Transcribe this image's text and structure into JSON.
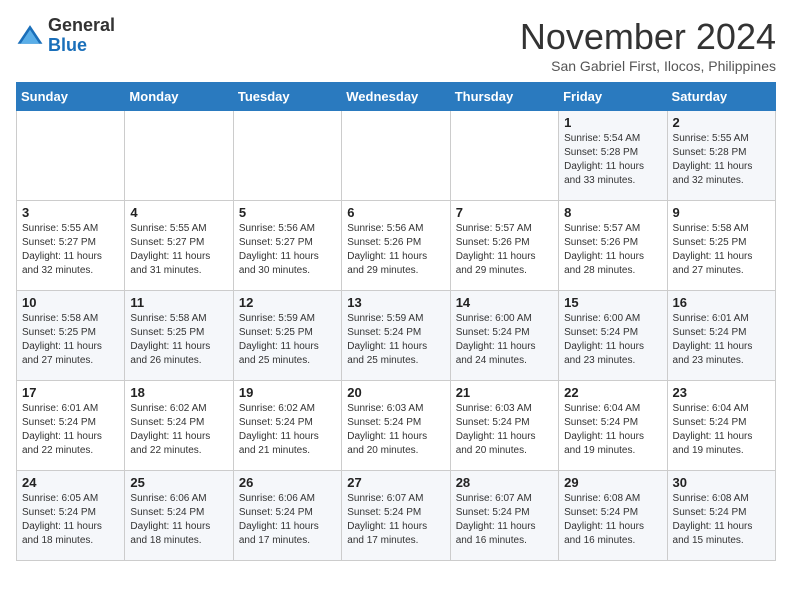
{
  "logo": {
    "general": "General",
    "blue": "Blue"
  },
  "title": "November 2024",
  "subtitle": "San Gabriel First, Ilocos, Philippines",
  "days_header": [
    "Sunday",
    "Monday",
    "Tuesday",
    "Wednesday",
    "Thursday",
    "Friday",
    "Saturday"
  ],
  "weeks": [
    [
      {
        "day": "",
        "sunrise": "",
        "sunset": "",
        "daylight": ""
      },
      {
        "day": "",
        "sunrise": "",
        "sunset": "",
        "daylight": ""
      },
      {
        "day": "",
        "sunrise": "",
        "sunset": "",
        "daylight": ""
      },
      {
        "day": "",
        "sunrise": "",
        "sunset": "",
        "daylight": ""
      },
      {
        "day": "",
        "sunrise": "",
        "sunset": "",
        "daylight": ""
      },
      {
        "day": "1",
        "sunrise": "Sunrise: 5:54 AM",
        "sunset": "Sunset: 5:28 PM",
        "daylight": "Daylight: 11 hours and 33 minutes."
      },
      {
        "day": "2",
        "sunrise": "Sunrise: 5:55 AM",
        "sunset": "Sunset: 5:28 PM",
        "daylight": "Daylight: 11 hours and 32 minutes."
      }
    ],
    [
      {
        "day": "3",
        "sunrise": "Sunrise: 5:55 AM",
        "sunset": "Sunset: 5:27 PM",
        "daylight": "Daylight: 11 hours and 32 minutes."
      },
      {
        "day": "4",
        "sunrise": "Sunrise: 5:55 AM",
        "sunset": "Sunset: 5:27 PM",
        "daylight": "Daylight: 11 hours and 31 minutes."
      },
      {
        "day": "5",
        "sunrise": "Sunrise: 5:56 AM",
        "sunset": "Sunset: 5:27 PM",
        "daylight": "Daylight: 11 hours and 30 minutes."
      },
      {
        "day": "6",
        "sunrise": "Sunrise: 5:56 AM",
        "sunset": "Sunset: 5:26 PM",
        "daylight": "Daylight: 11 hours and 29 minutes."
      },
      {
        "day": "7",
        "sunrise": "Sunrise: 5:57 AM",
        "sunset": "Sunset: 5:26 PM",
        "daylight": "Daylight: 11 hours and 29 minutes."
      },
      {
        "day": "8",
        "sunrise": "Sunrise: 5:57 AM",
        "sunset": "Sunset: 5:26 PM",
        "daylight": "Daylight: 11 hours and 28 minutes."
      },
      {
        "day": "9",
        "sunrise": "Sunrise: 5:58 AM",
        "sunset": "Sunset: 5:25 PM",
        "daylight": "Daylight: 11 hours and 27 minutes."
      }
    ],
    [
      {
        "day": "10",
        "sunrise": "Sunrise: 5:58 AM",
        "sunset": "Sunset: 5:25 PM",
        "daylight": "Daylight: 11 hours and 27 minutes."
      },
      {
        "day": "11",
        "sunrise": "Sunrise: 5:58 AM",
        "sunset": "Sunset: 5:25 PM",
        "daylight": "Daylight: 11 hours and 26 minutes."
      },
      {
        "day": "12",
        "sunrise": "Sunrise: 5:59 AM",
        "sunset": "Sunset: 5:25 PM",
        "daylight": "Daylight: 11 hours and 25 minutes."
      },
      {
        "day": "13",
        "sunrise": "Sunrise: 5:59 AM",
        "sunset": "Sunset: 5:24 PM",
        "daylight": "Daylight: 11 hours and 25 minutes."
      },
      {
        "day": "14",
        "sunrise": "Sunrise: 6:00 AM",
        "sunset": "Sunset: 5:24 PM",
        "daylight": "Daylight: 11 hours and 24 minutes."
      },
      {
        "day": "15",
        "sunrise": "Sunrise: 6:00 AM",
        "sunset": "Sunset: 5:24 PM",
        "daylight": "Daylight: 11 hours and 23 minutes."
      },
      {
        "day": "16",
        "sunrise": "Sunrise: 6:01 AM",
        "sunset": "Sunset: 5:24 PM",
        "daylight": "Daylight: 11 hours and 23 minutes."
      }
    ],
    [
      {
        "day": "17",
        "sunrise": "Sunrise: 6:01 AM",
        "sunset": "Sunset: 5:24 PM",
        "daylight": "Daylight: 11 hours and 22 minutes."
      },
      {
        "day": "18",
        "sunrise": "Sunrise: 6:02 AM",
        "sunset": "Sunset: 5:24 PM",
        "daylight": "Daylight: 11 hours and 22 minutes."
      },
      {
        "day": "19",
        "sunrise": "Sunrise: 6:02 AM",
        "sunset": "Sunset: 5:24 PM",
        "daylight": "Daylight: 11 hours and 21 minutes."
      },
      {
        "day": "20",
        "sunrise": "Sunrise: 6:03 AM",
        "sunset": "Sunset: 5:24 PM",
        "daylight": "Daylight: 11 hours and 20 minutes."
      },
      {
        "day": "21",
        "sunrise": "Sunrise: 6:03 AM",
        "sunset": "Sunset: 5:24 PM",
        "daylight": "Daylight: 11 hours and 20 minutes."
      },
      {
        "day": "22",
        "sunrise": "Sunrise: 6:04 AM",
        "sunset": "Sunset: 5:24 PM",
        "daylight": "Daylight: 11 hours and 19 minutes."
      },
      {
        "day": "23",
        "sunrise": "Sunrise: 6:04 AM",
        "sunset": "Sunset: 5:24 PM",
        "daylight": "Daylight: 11 hours and 19 minutes."
      }
    ],
    [
      {
        "day": "24",
        "sunrise": "Sunrise: 6:05 AM",
        "sunset": "Sunset: 5:24 PM",
        "daylight": "Daylight: 11 hours and 18 minutes."
      },
      {
        "day": "25",
        "sunrise": "Sunrise: 6:06 AM",
        "sunset": "Sunset: 5:24 PM",
        "daylight": "Daylight: 11 hours and 18 minutes."
      },
      {
        "day": "26",
        "sunrise": "Sunrise: 6:06 AM",
        "sunset": "Sunset: 5:24 PM",
        "daylight": "Daylight: 11 hours and 17 minutes."
      },
      {
        "day": "27",
        "sunrise": "Sunrise: 6:07 AM",
        "sunset": "Sunset: 5:24 PM",
        "daylight": "Daylight: 11 hours and 17 minutes."
      },
      {
        "day": "28",
        "sunrise": "Sunrise: 6:07 AM",
        "sunset": "Sunset: 5:24 PM",
        "daylight": "Daylight: 11 hours and 16 minutes."
      },
      {
        "day": "29",
        "sunrise": "Sunrise: 6:08 AM",
        "sunset": "Sunset: 5:24 PM",
        "daylight": "Daylight: 11 hours and 16 minutes."
      },
      {
        "day": "30",
        "sunrise": "Sunrise: 6:08 AM",
        "sunset": "Sunset: 5:24 PM",
        "daylight": "Daylight: 11 hours and 15 minutes."
      }
    ]
  ]
}
